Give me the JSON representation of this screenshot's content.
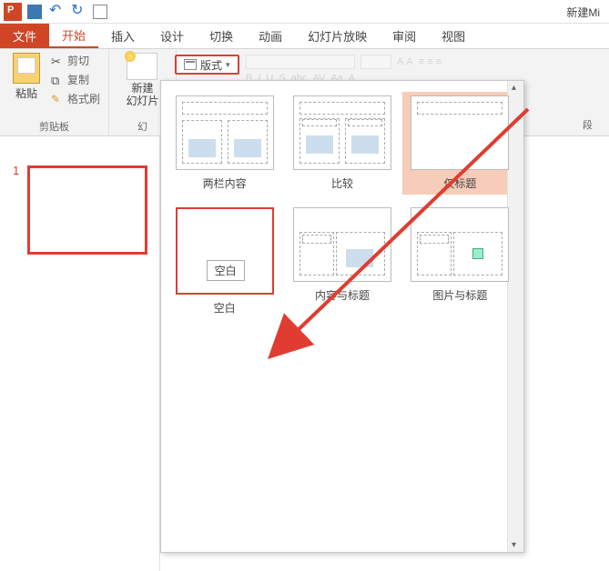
{
  "qat": {
    "title": "新建Mi"
  },
  "tabs": {
    "file": "文件",
    "home": "开始",
    "insert": "插入",
    "design": "设计",
    "transition": "切换",
    "animation": "动画",
    "slideshow": "幻灯片放映",
    "review": "审阅",
    "view": "视图"
  },
  "ribbon": {
    "clipboard": {
      "paste": "粘贴",
      "cut": "剪切",
      "copy": "复制",
      "format": "格式刷",
      "title": "剪贴板"
    },
    "slides": {
      "newslide": "新建\n幻灯片",
      "title": "幻"
    },
    "layout_btn": "版式",
    "right_label": "段"
  },
  "slidepanel": {
    "num": "1"
  },
  "layouts": {
    "two_content": "两栏内容",
    "comparison": "比较",
    "title_only": "仅标题",
    "blank": "空白",
    "blank_tooltip": "空白",
    "content_caption": "内容与标题",
    "picture_caption": "图片与标题"
  }
}
